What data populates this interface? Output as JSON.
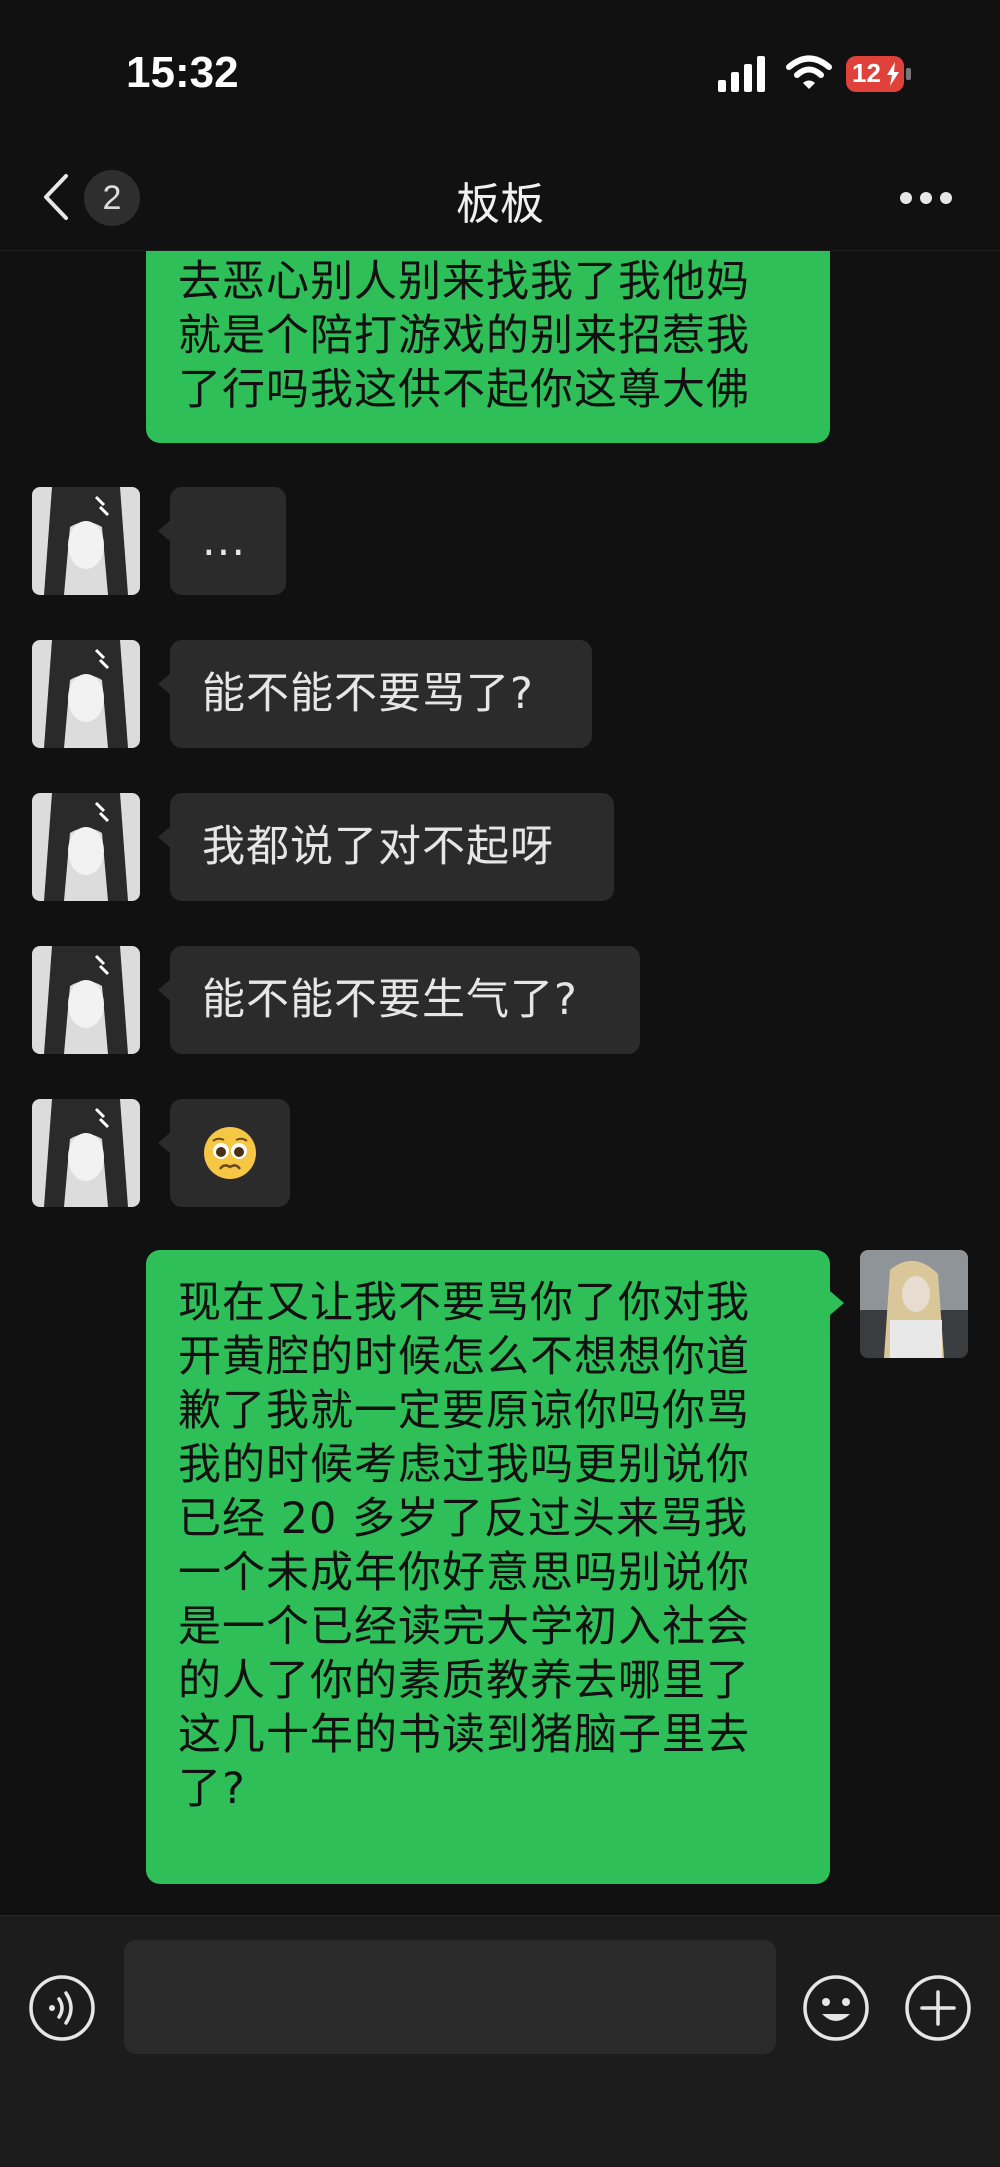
{
  "status_bar": {
    "time": "15:32",
    "battery": "12"
  },
  "header": {
    "back_badge": "2",
    "title": "板板"
  },
  "messages": [
    {
      "side": "out",
      "lines": [
        "去恶心别人别来找我了我他妈",
        "就是个陪打游戏的别来招惹我",
        "了行吗我这供不起你这尊大佛"
      ]
    },
    {
      "side": "in",
      "text": "..."
    },
    {
      "side": "in",
      "text": "能不能不要骂了?"
    },
    {
      "side": "in",
      "text": "我都说了对不起呀"
    },
    {
      "side": "in",
      "text": "能不能不要生气了?"
    },
    {
      "side": "in",
      "emoji": "pleading-face-emoji"
    },
    {
      "side": "out",
      "lines": [
        "现在又让我不要骂你了你对我",
        "开黄腔的时候怎么不想想你道",
        "歉了我就一定要原谅你吗你骂",
        "我的时候考虑过我吗更别说你",
        "已经 20 多岁了反过头来骂我",
        "一个未成年你好意思吗别说你",
        "是一个已经读完大学初入社会",
        "的人了你的素质教养去哪里了",
        "这几十年的书读到猪脑子里去",
        "了?"
      ]
    }
  ],
  "input": {
    "value": ""
  },
  "colors": {
    "outgoing_bubble": "#2fbf59",
    "incoming_bubble": "#2b2b2b",
    "background": "#111111",
    "battery_low": "#e0413a"
  }
}
